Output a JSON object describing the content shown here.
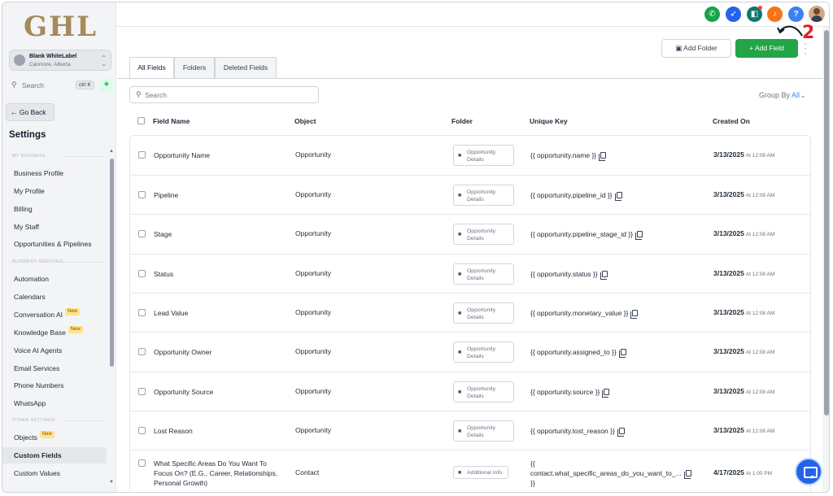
{
  "app": {
    "logo_text": "GHL"
  },
  "account": {
    "name": "Blank WhiteLabel",
    "location": "Canmore, Alberta"
  },
  "sidebar": {
    "search_label": "Search",
    "search_shortcut": "ctrl K",
    "go_back": "Go Back",
    "settings_title": "Settings",
    "sections": {
      "my_business": "MY BUSINESS",
      "business_services": "BUSINESS SERVICES",
      "other_settings": "OTHER SETTINGS"
    },
    "items": {
      "business_profile": "Business Profile",
      "my_profile": "My Profile",
      "billing": "Billing",
      "my_staff": "My Staff",
      "opportunities_pipelines": "Opportunities & Pipelines",
      "automation": "Automation",
      "calendars": "Calendars",
      "conversation_ai": "Conversation AI",
      "knowledge_base": "Knowledge Base",
      "voice_ai_agents": "Voice AI Agents",
      "email_services": "Email Services",
      "phone_numbers": "Phone Numbers",
      "whatsapp": "WhatsApp",
      "objects": "Objects",
      "custom_fields": "Custom Fields",
      "custom_values": "Custom Values"
    },
    "new_badge": "New"
  },
  "topbar": {
    "icons": [
      "phone-icon",
      "megaphone-icon",
      "announcement-icon",
      "bell-icon",
      "help-icon"
    ],
    "help_label": "?",
    "annotation_number": "2"
  },
  "actions": {
    "add_folder": "Add Folder",
    "add_field": "+ Add Field"
  },
  "tabs": {
    "all_fields": "All Fields",
    "folders": "Folders",
    "deleted_fields": "Deleted Fields"
  },
  "search": {
    "placeholder": "Search"
  },
  "group_by": {
    "label": "Group By",
    "value": "All"
  },
  "table": {
    "headers": {
      "field_name": "Field Name",
      "object": "Object",
      "folder": "Folder",
      "unique_key": "Unique Key",
      "created_on": "Created On"
    },
    "rows": [
      {
        "name": "Opportunity Name",
        "object": "Opportunity",
        "folder": "Opportunity Details",
        "key": "{{ opportunity.name }}",
        "date": "3/13/2025",
        "time": "At 12:08 AM"
      },
      {
        "name": "Pipeline",
        "object": "Opportunity",
        "folder": "Opportunity Details",
        "key": "{{ opportunity.pipeline_id }}",
        "date": "3/13/2025",
        "time": "At 12:08 AM"
      },
      {
        "name": "Stage",
        "object": "Opportunity",
        "folder": "Opportunity Details",
        "key": "{{ opportunity.pipeline_stage_id }}",
        "date": "3/13/2025",
        "time": "At 12:08 AM"
      },
      {
        "name": "Status",
        "object": "Opportunity",
        "folder": "Opportunity Details",
        "key": "{{ opportunity.status }}",
        "date": "3/13/2025",
        "time": "At 12:08 AM"
      },
      {
        "name": "Lead Value",
        "object": "Opportunity",
        "folder": "Opportunity Details",
        "key": "{{ opportunity.monetary_value }}",
        "date": "3/13/2025",
        "time": "At 12:08 AM"
      },
      {
        "name": "Opportunity Owner",
        "object": "Opportunity",
        "folder": "Opportunity Details",
        "key": "{{ opportunity.assigned_to }}",
        "date": "3/13/2025",
        "time": "At 12:08 AM"
      },
      {
        "name": "Opportunity Source",
        "object": "Opportunity",
        "folder": "Opportunity Details",
        "key": "{{ opportunity.source }}",
        "date": "3/13/2025",
        "time": "At 12:08 AM"
      },
      {
        "name": "Lost Reason",
        "object": "Opportunity",
        "folder": "Opportunity Details",
        "key": "{{ opportunity.lost_reason }}",
        "date": "3/13/2025",
        "time": "At 12:08 AM"
      },
      {
        "name_lines": [
          "What Specific Areas Do You Want To",
          "Focus On? (E.G., Career, Relationships,",
          "Personal Growth)"
        ],
        "object": "Contact",
        "folder": "Additional Info",
        "key_lines": [
          "{{",
          "contact.what_specific_areas_do_you_want_to_...",
          "}}"
        ],
        "date": "4/17/2025",
        "time": "At 1:00 PM"
      }
    ]
  }
}
